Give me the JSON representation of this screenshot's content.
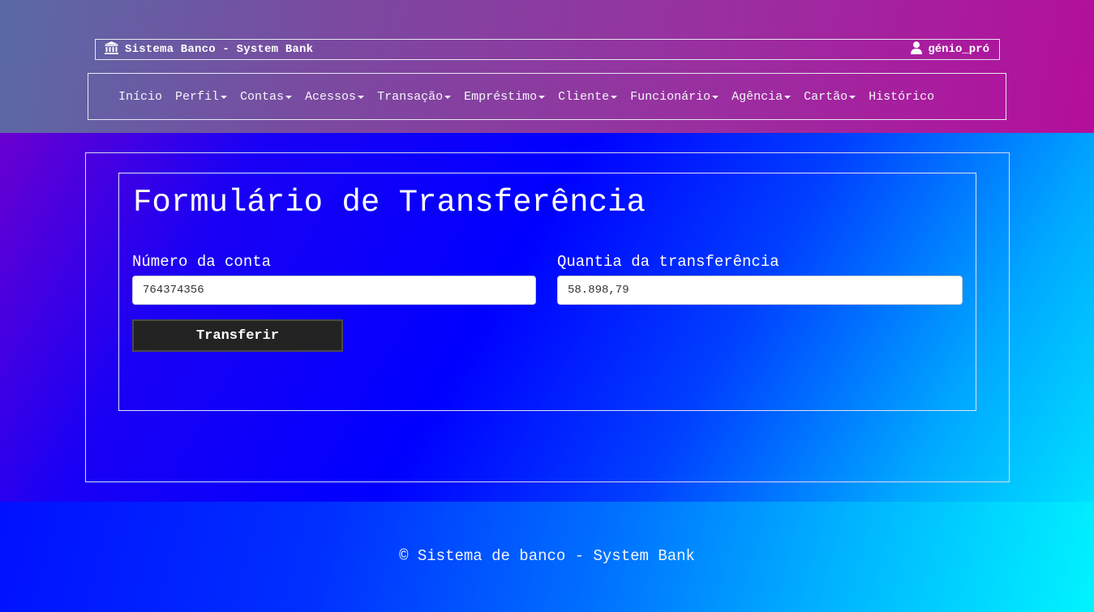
{
  "header": {
    "brand_icon": "bank-icon",
    "brand_title": "Sistema Banco - System Bank",
    "user_icon": "user-icon",
    "username": "génio_pró"
  },
  "nav": {
    "items": [
      {
        "label": "Início",
        "dropdown": false
      },
      {
        "label": "Perfil",
        "dropdown": true
      },
      {
        "label": "Contas",
        "dropdown": true
      },
      {
        "label": "Acessos",
        "dropdown": true
      },
      {
        "label": "Transação",
        "dropdown": true
      },
      {
        "label": "Empréstimo",
        "dropdown": true
      },
      {
        "label": "Cliente",
        "dropdown": true
      },
      {
        "label": "Funcionário",
        "dropdown": true
      },
      {
        "label": "Agência",
        "dropdown": true
      },
      {
        "label": "Cartão",
        "dropdown": true
      },
      {
        "label": "Histórico",
        "dropdown": false
      }
    ]
  },
  "form": {
    "title": "Formulário de Transferência",
    "account_label": "Número da conta",
    "account_value": "764374356",
    "amount_label": "Quantia da transferência",
    "amount_value": "58.898,79",
    "submit_label": "Transferir"
  },
  "footer": {
    "text": "© Sistema de banco - System Bank"
  },
  "colors": {
    "button_bg": "#232323",
    "text": "#ffffff"
  }
}
